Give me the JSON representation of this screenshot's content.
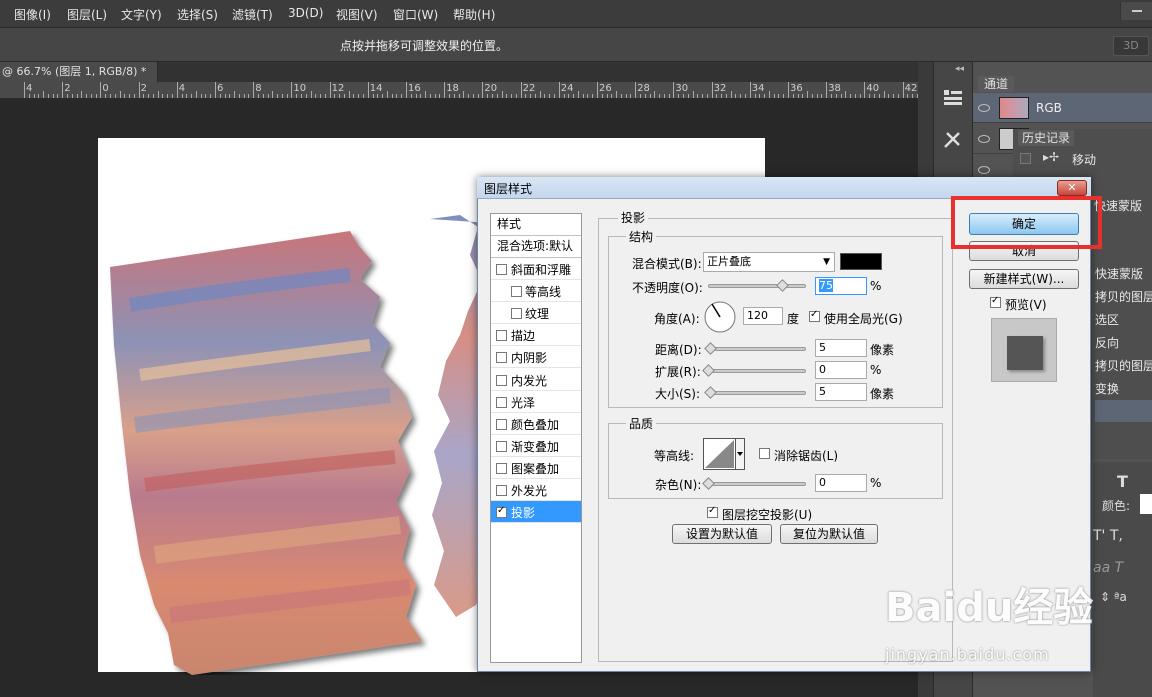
{
  "menubar": {
    "items": [
      "图像(I)",
      "图层(L)",
      "文字(Y)",
      "选择(S)",
      "滤镜(T)",
      "3D(D)",
      "视图(V)",
      "窗口(W)",
      "帮助(H)"
    ]
  },
  "options_bar": {
    "hint": "点按并拖移可调整效果的位置。",
    "mode_3d": "3D"
  },
  "document": {
    "tab_label": "@ 66.7% (图层 1, RGB/8) *",
    "close": "×"
  },
  "ruler": {
    "labels": [
      "4",
      "2",
      "0",
      "2",
      "4",
      "6",
      "8",
      "10",
      "12",
      "14",
      "16",
      "18",
      "20",
      "22",
      "24",
      "26",
      "28",
      "30",
      "32",
      "34",
      "36",
      "38",
      "40",
      "42"
    ]
  },
  "panels": {
    "collapse": "◂◂",
    "channels_tab": "通道",
    "channel_rgb": "RGB",
    "history_tab": "历史记录",
    "history_items": [
      "移动"
    ],
    "history_partial": [
      "快速蒙版",
      "快速蒙版",
      "拷贝的图层",
      "选区",
      "反向",
      "拷贝的图层",
      "变换"
    ],
    "char_color_label": "颜色:"
  },
  "dialog": {
    "title": "图层样式",
    "close": "✕",
    "styles_header": "样式",
    "blend_options": "混合选项:默认",
    "style_items": [
      {
        "label": "斜面和浮雕",
        "checked": false
      },
      {
        "label": "等高线",
        "checked": false
      },
      {
        "label": "纹理",
        "checked": false
      },
      {
        "label": "描边",
        "checked": false
      },
      {
        "label": "内阴影",
        "checked": false
      },
      {
        "label": "内发光",
        "checked": false
      },
      {
        "label": "光泽",
        "checked": false
      },
      {
        "label": "颜色叠加",
        "checked": false
      },
      {
        "label": "渐变叠加",
        "checked": false
      },
      {
        "label": "图案叠加",
        "checked": false
      },
      {
        "label": "外发光",
        "checked": false
      },
      {
        "label": "投影",
        "checked": true
      }
    ],
    "section_title": "投影",
    "structure_title": "结构",
    "blend_mode_label": "混合模式(B):",
    "blend_mode_value": "正片叠底",
    "shadow_color": "#000000",
    "opacity_label": "不透明度(O):",
    "opacity_value": "75",
    "percent": "%",
    "angle_label": "角度(A):",
    "angle_value": "120",
    "angle_unit": "度",
    "global_light_label": "使用全局光(G)",
    "global_light_checked": true,
    "distance_label": "距离(D):",
    "distance_value": "5",
    "spread_label": "扩展(R):",
    "spread_value": "0",
    "size_label": "大小(S):",
    "size_value": "5",
    "pixels": "像素",
    "quality_title": "品质",
    "contour_label": "等高线:",
    "anti_alias_label": "消除锯齿(L)",
    "noise_label": "杂色(N):",
    "noise_value": "0",
    "knockout_label": "图层挖空投影(U)",
    "knockout_checked": true,
    "set_default": "设置为默认值",
    "reset_default": "复位为默认值",
    "ok": "确定",
    "cancel": "取消",
    "new_style": "新建样式(W)...",
    "preview_label": "预览(V)",
    "preview_checked": true,
    "opacity_level_pct": 75,
    "distance_level_pct": 2,
    "spread_level_pct": 0,
    "size_level_pct": 2,
    "noise_level_pct": 0
  },
  "watermark": {
    "brand": "Baidu经验",
    "url": "jingyan.baidu.com"
  }
}
